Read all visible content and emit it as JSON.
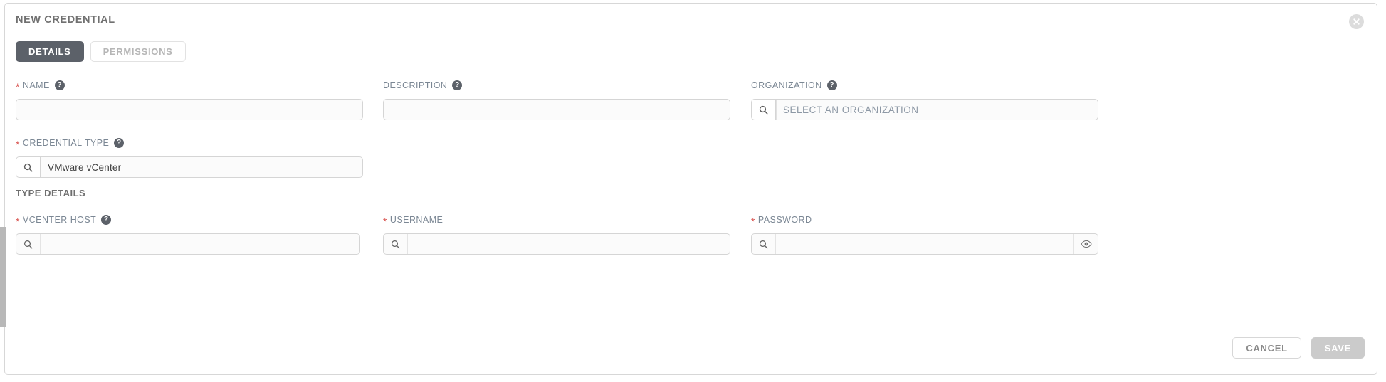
{
  "panel": {
    "title": "NEW CREDENTIAL",
    "close_icon": "close-circle-icon"
  },
  "tabs": [
    {
      "label": "DETAILS",
      "active": true
    },
    {
      "label": "PERMISSIONS",
      "active": false
    }
  ],
  "fields": {
    "name": {
      "label": "NAME",
      "required": true,
      "help": "?",
      "value": "",
      "placeholder": ""
    },
    "description": {
      "label": "DESCRIPTION",
      "required": false,
      "help": "?",
      "value": "",
      "placeholder": ""
    },
    "organization": {
      "label": "ORGANIZATION",
      "required": false,
      "help": "?",
      "value": "",
      "placeholder": "SELECT AN ORGANIZATION",
      "prefix_icon": "search-icon"
    },
    "credential_type": {
      "label": "CREDENTIAL TYPE",
      "required": true,
      "help": "?",
      "value": "VMware vCenter",
      "placeholder": "",
      "prefix_icon": "search-icon"
    },
    "vcenter_host": {
      "label": "VCENTER HOST",
      "required": true,
      "help": "?",
      "value": "",
      "placeholder": "",
      "prefix_icon": "search-icon"
    },
    "username": {
      "label": "USERNAME",
      "required": true,
      "value": "",
      "placeholder": "",
      "prefix_icon": "search-icon"
    },
    "password": {
      "label": "PASSWORD",
      "required": true,
      "value": "",
      "placeholder": "",
      "prefix_icon": "search-icon",
      "suffix_icon": "eye-icon"
    }
  },
  "sections": {
    "type_details": "TYPE DETAILS"
  },
  "footer": {
    "cancel_label": "CANCEL",
    "save_label": "SAVE",
    "save_disabled": true
  },
  "colors": {
    "accent_tab": "#5c6169",
    "required_star": "#d9534f",
    "label_text": "#7b8794",
    "input_border": "#d5d5d5",
    "input_fill": "#fbfbfb",
    "save_disabled_bg": "#cbcbcb",
    "scrollbar_thumb": "#b8b8b8"
  }
}
